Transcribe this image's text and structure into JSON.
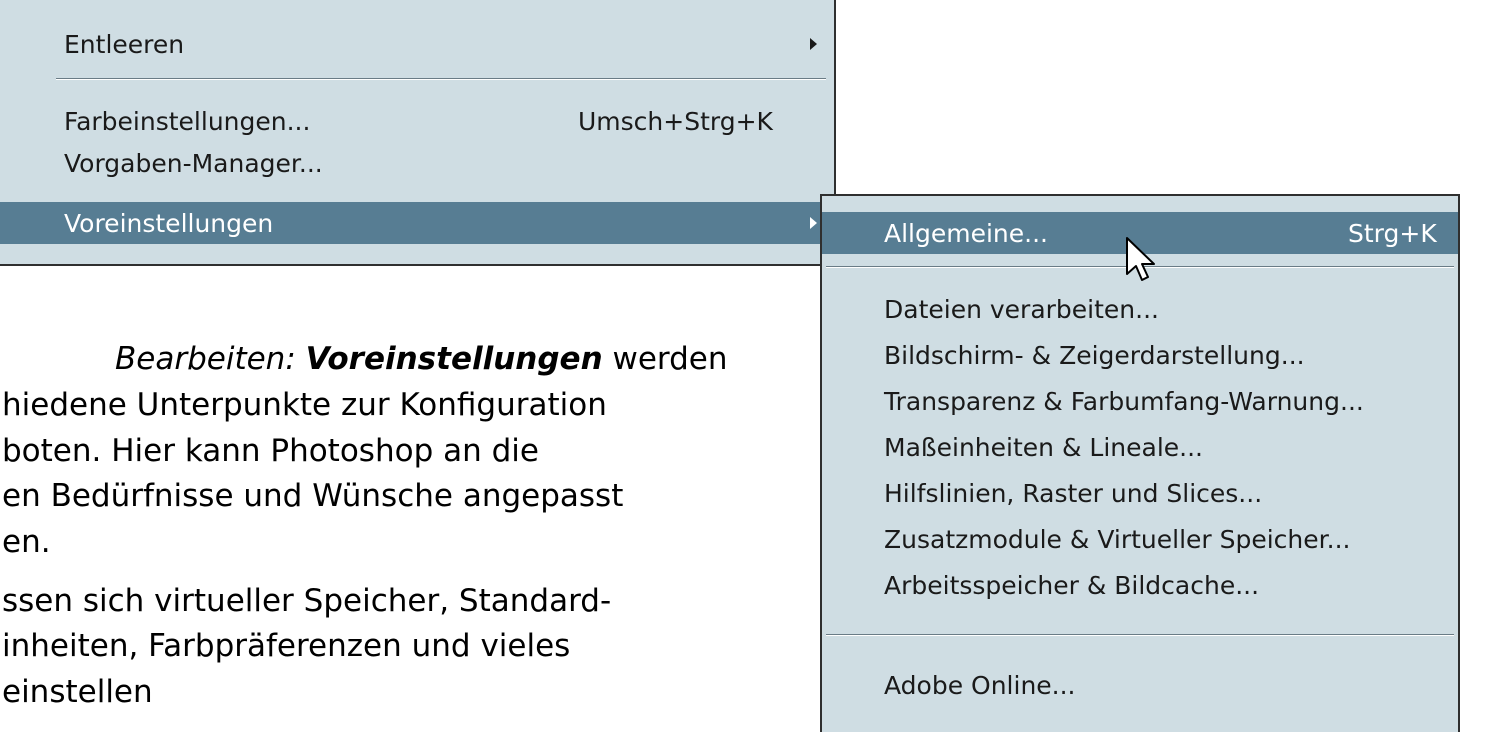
{
  "background_text": {
    "lines": [
      {
        "italic": "Bearbeiten: ",
        "bold": "Voreinstellungen",
        "rest": " werden"
      },
      {
        "text": "hiedene Unterpunkte zur Konfiguration"
      },
      {
        "text": "boten. Hier kann Photoshop an die"
      },
      {
        "text": "en Bedürfnisse und Wünsche angepasst"
      },
      {
        "text": "en."
      },
      {
        "text": "ssen sich virtueller Speicher, Standard-"
      },
      {
        "text": "inheiten, Farbpräferenzen und vieles"
      },
      {
        "text": "einstellen"
      }
    ]
  },
  "main_menu": {
    "items": [
      {
        "label": "Entleeren",
        "shortcut": "",
        "submenu": true
      },
      {
        "label": "Farbeinstellungen...",
        "shortcut": "Umsch+Strg+K",
        "submenu": false
      },
      {
        "label": "Vorgaben-Manager...",
        "shortcut": "",
        "submenu": false
      },
      {
        "label": "Voreinstellungen",
        "shortcut": "",
        "submenu": true,
        "active": true
      }
    ]
  },
  "submenu": {
    "items": [
      {
        "label": "Allgemeine...",
        "shortcut": "Strg+K",
        "active": true
      },
      {
        "label": "Dateien verarbeiten...",
        "shortcut": ""
      },
      {
        "label": "Bildschirm- & Zeigerdarstellung...",
        "shortcut": ""
      },
      {
        "label": "Transparenz & Farbumfang-Warnung...",
        "shortcut": ""
      },
      {
        "label": "Maßeinheiten & Lineale...",
        "shortcut": ""
      },
      {
        "label": "Hilfslinien, Raster und Slices...",
        "shortcut": ""
      },
      {
        "label": "Zusatzmodule & Virtueller Speicher...",
        "shortcut": ""
      },
      {
        "label": "Arbeitsspeicher & Bildcache...",
        "shortcut": ""
      },
      {
        "label": "Adobe Online...",
        "shortcut": ""
      }
    ]
  },
  "colors": {
    "menu_background": "#cfdde3",
    "highlight": "#577d93",
    "border": "#2f2f2f"
  },
  "icons": {
    "cursor": "arrow-cursor-icon",
    "submenu_arrow": "submenu-arrow-icon"
  }
}
